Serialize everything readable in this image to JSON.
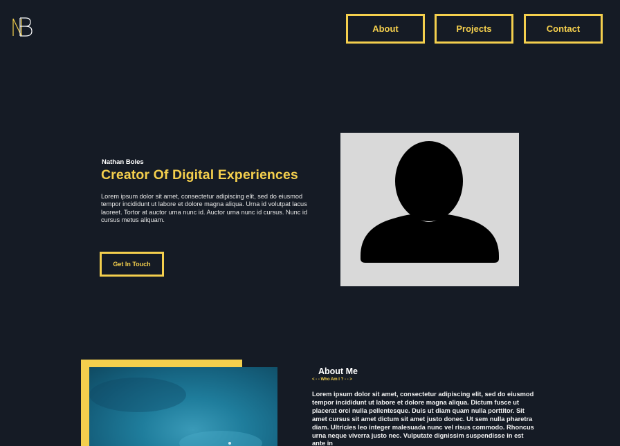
{
  "header": {
    "logo_alt": "NB logo",
    "nav": [
      {
        "label": "About"
      },
      {
        "label": "Projects"
      },
      {
        "label": "Contact"
      }
    ]
  },
  "hero": {
    "name": "Nathan Boles",
    "title": "Creator Of Digital Experiences",
    "description": "Lorem ipsum dolor sit amet, consectetur adipiscing elit, sed do eiusmod  tempor incididunt ut labore et dolore magna aliqua. Urna id volutpat  lacus laoreet. Tortor at auctor urna nunc id. Auctor urna nunc id  cursus. Nunc id cursus metus aliquam.",
    "cta_label": "Get In Touch",
    "avatar_icon": "user-silhouette-icon"
  },
  "about": {
    "title": "About Me",
    "subtitle": "< - - Who Am I ? - - >",
    "text": "Lorem ipsum dolor sit amet, consectetur adipiscing elit, sed do eiusmod  tempor incididunt ut labore et dolore magna aliqua. Dictum fusce ut  placerat orci nulla pellentesque. Duis ut diam quam nulla porttitor. Sit  amet cursus sit amet dictum sit amet justo donec. Ut sem nulla pharetra  diam. Ultricies leo integer malesuada nunc vel risus commodo. Rhoncus  urna neque viverra justo nec. Vulputate dignissim suspendisse in est  ante in"
  },
  "colors": {
    "background": "#151b25",
    "accent": "#f4cf4d",
    "text": "#ffffff",
    "avatar_bg": "#d9d9d9"
  }
}
